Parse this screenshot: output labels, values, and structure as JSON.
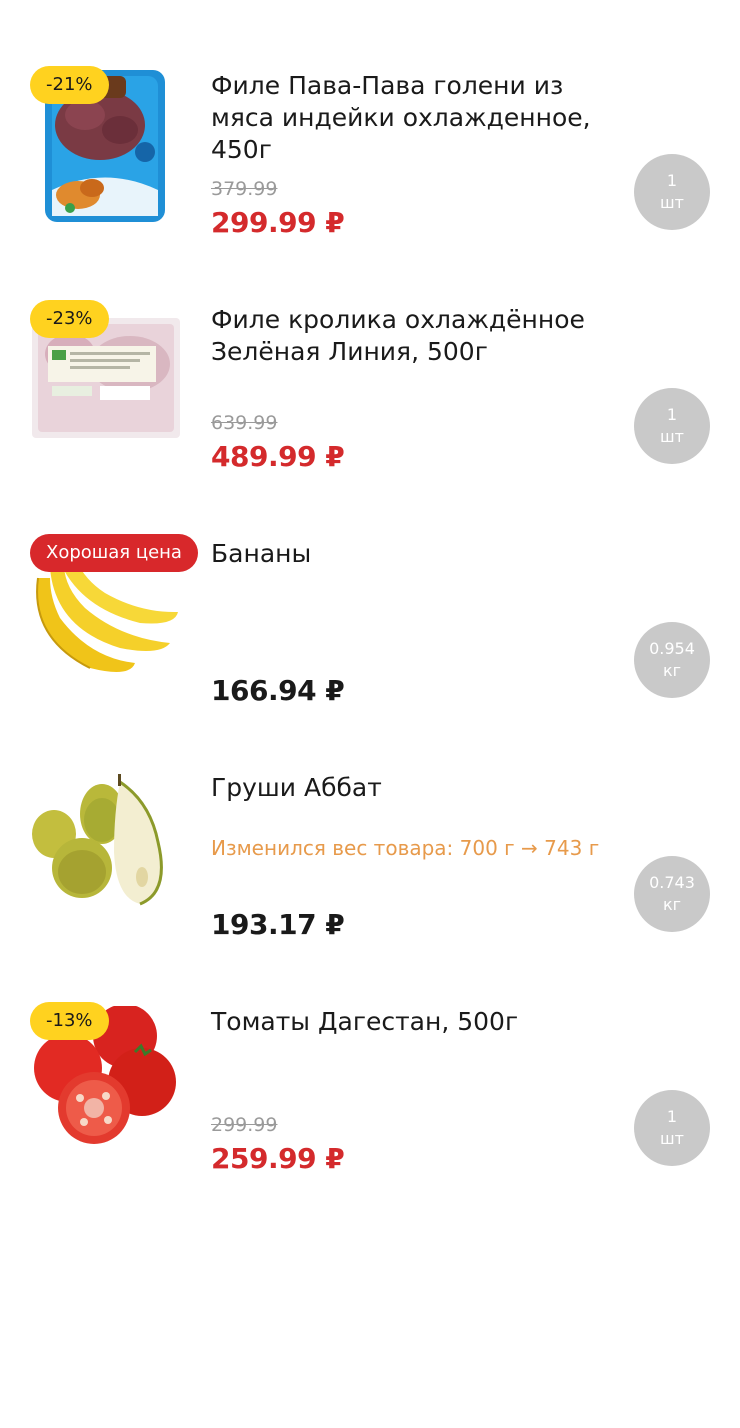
{
  "items": [
    {
      "badge": "-21%",
      "title": "Филе Пава-Пава голени из мяса индейки охлажденное, 450г",
      "old_price": "379.99",
      "price": "299.99 ₽",
      "qty_value": "1",
      "qty_unit": "шт",
      "image": "turkey-package-image"
    },
    {
      "badge": "-23%",
      "title": "Филе кролика охлаждённое Зелёная Линия, 500г",
      "old_price": "639.99",
      "price": "489.99 ₽",
      "qty_value": "1",
      "qty_unit": "шт",
      "image": "rabbit-package-image"
    },
    {
      "badge": "Хорошая цена",
      "title": "Бананы",
      "price": "166.94 ₽",
      "qty_value": "0.954",
      "qty_unit": "кг",
      "image": "bananas-image"
    },
    {
      "title": "Груши Аббат",
      "note": "Изменился вес товара: 700 г → 743 г",
      "price": "193.17 ₽",
      "qty_value": "0.743",
      "qty_unit": "кг",
      "image": "pears-image"
    },
    {
      "badge": "-13%",
      "title": "Томаты Дагестан, 500г",
      "old_price": "299.99",
      "price": "259.99 ₽",
      "qty_value": "1",
      "qty_unit": "шт",
      "image": "tomatoes-image"
    }
  ],
  "colors": {
    "sale_price": "#d42a2c",
    "discount_badge": "#ffd21f",
    "good_price_badge": "#d8282b",
    "weight_note": "#e79a4b",
    "qty_circle": "#c9c9c9"
  }
}
